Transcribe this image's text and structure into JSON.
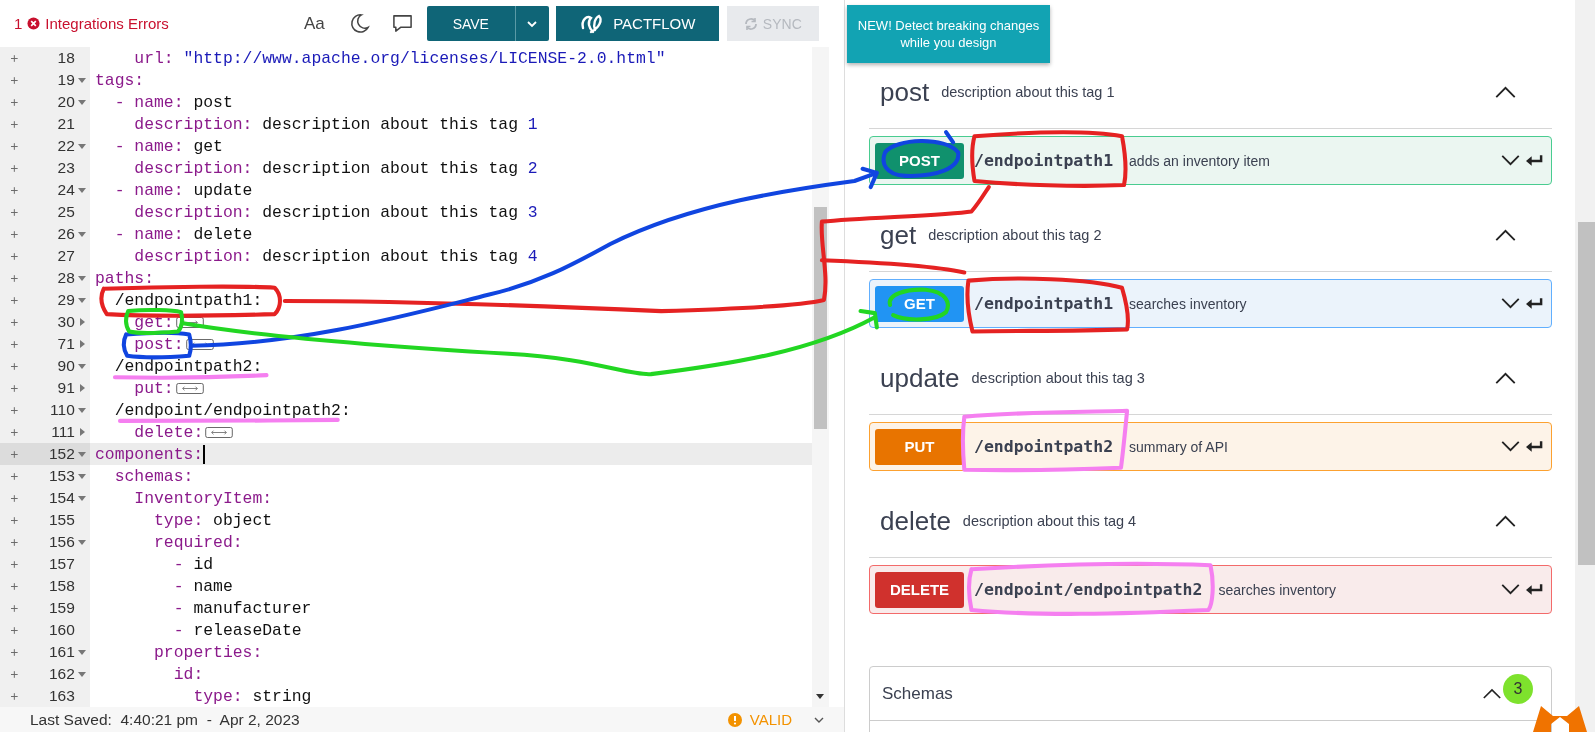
{
  "header": {
    "errors": {
      "count": "1",
      "label": "Integrations Errors"
    },
    "font_toggle": "Aa",
    "save": "SAVE",
    "pactflow": "PACTFLOW",
    "sync": {
      "label": "SYNC",
      "disabled": true
    },
    "tooltip": "NEW! Detect breaking changes while you design"
  },
  "editor": {
    "lines": [
      {
        "number": "18",
        "selected": false,
        "tokens": [
          {
            "kind": "key",
            "text": "    url: "
          },
          {
            "kind": "str",
            "text": "\"http://www.apache.org/licenses/LICENSE-2.0.html\""
          }
        ]
      },
      {
        "number": "19",
        "expanded": true,
        "selected": false,
        "tokens": [
          {
            "kind": "key",
            "text": "tags:"
          }
        ]
      },
      {
        "number": "20",
        "expanded": true,
        "selected": false,
        "tokens": [
          {
            "kind": "key",
            "text": "  - name: "
          },
          {
            "kind": "plain",
            "text": "post"
          }
        ]
      },
      {
        "number": "21",
        "selected": false,
        "tokens": [
          {
            "kind": "key",
            "text": "    description: "
          },
          {
            "kind": "plain",
            "text": "description about this tag "
          },
          {
            "kind": "num",
            "text": "1"
          }
        ]
      },
      {
        "number": "22",
        "expanded": true,
        "selected": false,
        "tokens": [
          {
            "kind": "key",
            "text": "  - name: "
          },
          {
            "kind": "plain",
            "text": "get"
          }
        ]
      },
      {
        "number": "23",
        "selected": false,
        "tokens": [
          {
            "kind": "key",
            "text": "    description: "
          },
          {
            "kind": "plain",
            "text": "description about this tag "
          },
          {
            "kind": "num",
            "text": "2"
          }
        ]
      },
      {
        "number": "24",
        "expanded": true,
        "selected": false,
        "tokens": [
          {
            "kind": "key",
            "text": "  - name: "
          },
          {
            "kind": "plain",
            "text": "update"
          }
        ]
      },
      {
        "number": "25",
        "selected": false,
        "tokens": [
          {
            "kind": "key",
            "text": "    description: "
          },
          {
            "kind": "plain",
            "text": "description about this tag "
          },
          {
            "kind": "num",
            "text": "3"
          }
        ]
      },
      {
        "number": "26",
        "expanded": true,
        "selected": false,
        "tokens": [
          {
            "kind": "key",
            "text": "  - name: "
          },
          {
            "kind": "plain",
            "text": "delete"
          }
        ]
      },
      {
        "number": "27",
        "selected": false,
        "tokens": [
          {
            "kind": "key",
            "text": "    description: "
          },
          {
            "kind": "plain",
            "text": "description about this tag "
          },
          {
            "kind": "num",
            "text": "4"
          }
        ]
      },
      {
        "number": "28",
        "expanded": true,
        "selected": false,
        "tokens": [
          {
            "kind": "key",
            "text": "paths:"
          }
        ]
      },
      {
        "number": "29",
        "expanded": true,
        "selected": false,
        "tokens": [
          {
            "kind": "plain",
            "text": "  /endpointpath1:"
          }
        ]
      },
      {
        "number": "30",
        "expanded": false,
        "selected": false,
        "tokens": [
          {
            "kind": "key",
            "text": "    get:"
          }
        ]
      },
      {
        "number": "71",
        "expanded": false,
        "selected": false,
        "tokens": [
          {
            "kind": "key",
            "text": "    post:"
          }
        ]
      },
      {
        "number": "90",
        "expanded": true,
        "selected": false,
        "tokens": [
          {
            "kind": "plain",
            "text": "  /endpointpath2:"
          }
        ]
      },
      {
        "number": "91",
        "expanded": false,
        "selected": false,
        "tokens": [
          {
            "kind": "key",
            "text": "    put:"
          }
        ]
      },
      {
        "number": "110",
        "expanded": true,
        "selected": false,
        "tokens": [
          {
            "kind": "plain",
            "text": "  /endpoint/endpointpath2:"
          }
        ]
      },
      {
        "number": "111",
        "expanded": false,
        "selected": false,
        "tokens": [
          {
            "kind": "key",
            "text": "    delete:"
          }
        ]
      },
      {
        "number": "152",
        "expanded": true,
        "selected": true,
        "tokens": [
          {
            "kind": "key",
            "text": "components:"
          }
        ]
      },
      {
        "number": "153",
        "expanded": true,
        "selected": false,
        "tokens": [
          {
            "kind": "key",
            "text": "  schemas:"
          }
        ]
      },
      {
        "number": "154",
        "expanded": true,
        "selected": false,
        "tokens": [
          {
            "kind": "key",
            "text": "    InventoryItem:"
          }
        ]
      },
      {
        "number": "155",
        "selected": false,
        "tokens": [
          {
            "kind": "key",
            "text": "      type: "
          },
          {
            "kind": "plain",
            "text": "object"
          }
        ]
      },
      {
        "number": "156",
        "expanded": true,
        "selected": false,
        "tokens": [
          {
            "kind": "key",
            "text": "      required:"
          }
        ]
      },
      {
        "number": "157",
        "selected": false,
        "tokens": [
          {
            "kind": "key",
            "text": "        - "
          },
          {
            "kind": "plain",
            "text": "id"
          }
        ]
      },
      {
        "number": "158",
        "selected": false,
        "tokens": [
          {
            "kind": "key",
            "text": "        - "
          },
          {
            "kind": "plain",
            "text": "name"
          }
        ]
      },
      {
        "number": "159",
        "selected": false,
        "tokens": [
          {
            "kind": "key",
            "text": "        - "
          },
          {
            "kind": "plain",
            "text": "manufacturer"
          }
        ]
      },
      {
        "number": "160",
        "selected": false,
        "tokens": [
          {
            "kind": "key",
            "text": "        - "
          },
          {
            "kind": "plain",
            "text": "releaseDate"
          }
        ]
      },
      {
        "number": "161",
        "expanded": true,
        "selected": false,
        "tokens": [
          {
            "kind": "key",
            "text": "      properties:"
          }
        ]
      },
      {
        "number": "162",
        "expanded": true,
        "selected": false,
        "tokens": [
          {
            "kind": "key",
            "text": "        id:"
          }
        ]
      },
      {
        "number": "163",
        "selected": false,
        "tokens": [
          {
            "kind": "key",
            "text": "          type: "
          },
          {
            "kind": "plain",
            "text": "string"
          }
        ]
      }
    ]
  },
  "status_bar": {
    "last_saved": "Last Saved:  4:40:21 pm  -  Apr 2, 2023",
    "validation": "VALID"
  },
  "docs": {
    "tags": [
      {
        "name": "post",
        "description": "description about this tag 1",
        "expanded": true,
        "operations": [
          {
            "kind": "post",
            "label": "POST",
            "path": "/endpointpath1",
            "summary": "adds an inventory item"
          }
        ]
      },
      {
        "name": "get",
        "description": "description about this tag 2",
        "expanded": true,
        "operations": [
          {
            "kind": "get",
            "label": "GET",
            "path": "/endpointpath1",
            "summary": "searches inventory"
          }
        ]
      },
      {
        "name": "update",
        "description": "description about this tag 3",
        "expanded": true,
        "operations": [
          {
            "kind": "put",
            "label": "PUT",
            "path": "/endpointpath2",
            "summary": "summary of API"
          }
        ]
      },
      {
        "name": "delete",
        "description": "description about this tag 4",
        "expanded": true,
        "operations": [
          {
            "kind": "delete",
            "label": "DELETE",
            "path": "/endpoint/endpointpath2",
            "summary": "searches inventory"
          }
        ]
      }
    ],
    "schemas": {
      "title": "Schemas",
      "expanded": true
    }
  },
  "notifications": {
    "count": "3"
  }
}
